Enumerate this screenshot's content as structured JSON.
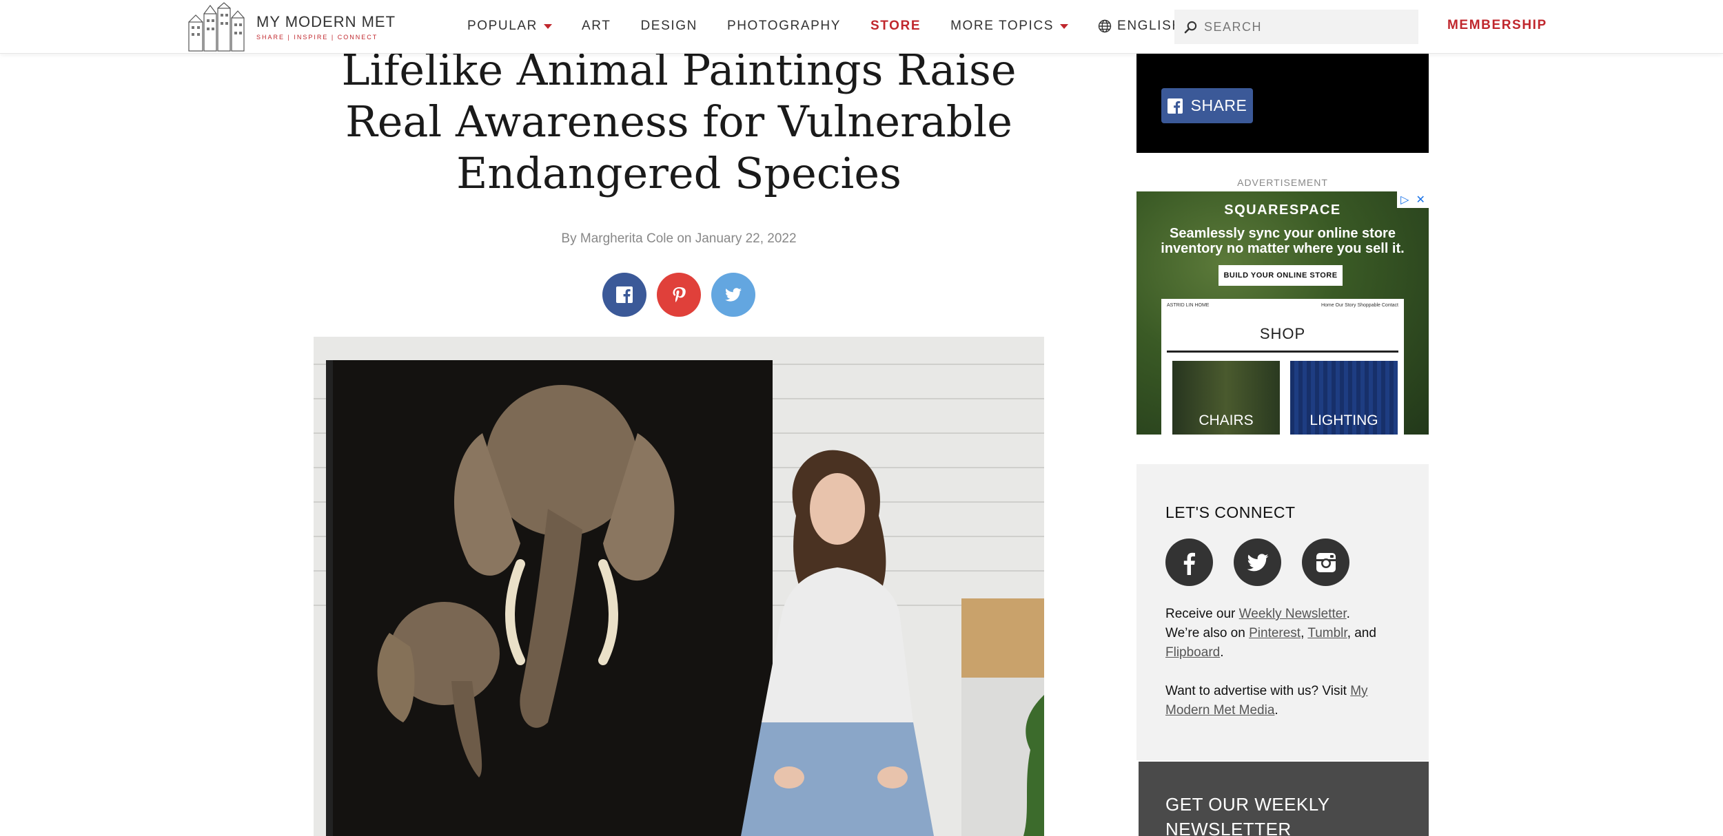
{
  "header": {
    "logo": {
      "name": "MY MODERN MET",
      "tagline": "SHARE | INSPIRE | CONNECT"
    },
    "nav": {
      "popular": "POPULAR",
      "art": "ART",
      "design": "DESIGN",
      "photography": "PHOTOGRAPHY",
      "store": "STORE",
      "more_topics": "MORE TOPICS",
      "language": "ENGLISH"
    },
    "search": {
      "placeholder": "SEARCH"
    },
    "membership": "MEMBERSHIP"
  },
  "article": {
    "title": "Lifelike Animal Paintings Raise Real Awareness for Vulnerable Endangered Species",
    "byline": "By Margherita Cole on January 22, 2022"
  },
  "sidebar": {
    "share_label": "SHARE",
    "ad_label": "ADVERTISEMENT",
    "ad": {
      "brand": "SQUARESPACE",
      "headline_line1": "Seamlessly sync your online store",
      "headline_line2": "inventory no matter where you sell it.",
      "cta": "BUILD YOUR ONLINE STORE",
      "site_name": "ASTRID LIN HOME",
      "site_nav": "Home   Our Story   Shoppable   Contact",
      "shop_heading": "SHOP",
      "tile_chairs": "CHAIRS",
      "tile_lighting": "LIGHTING"
    },
    "connect": {
      "title": "LET'S CONNECT",
      "receive_prefix": "Receive our ",
      "weekly_newsletter_link": "Weekly Newsletter",
      "period1": ".",
      "also_prefix": "We’re also on ",
      "pinterest_link": "Pinterest",
      "comma": ", ",
      "tumblr_link": "Tumblr",
      "and": ", and ",
      "flipboard_link": "Flipboard",
      "period2": ".",
      "advertise_prefix": "Want to advertise with us? Visit ",
      "mmm_media_link": "My Modern Met Media",
      "period3": "."
    },
    "newsletter_title": "GET OUR WEEKLY NEWSLETTER"
  },
  "colors": {
    "brand_red": "#c0272d",
    "facebook": "#3b5998",
    "pinterest": "#e0403a",
    "twitter": "#63a6e0"
  }
}
